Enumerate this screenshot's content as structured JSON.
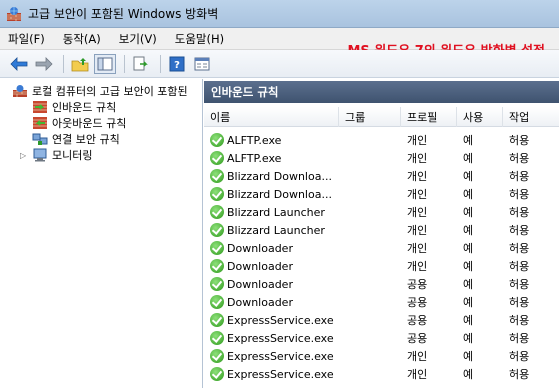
{
  "window": {
    "title": "고급 보안이 포함된 Windows 방화벽"
  },
  "menu": [
    "파일(F)",
    "동작(A)",
    "보기(V)",
    "도움말(H)"
  ],
  "overlay": "MS 윈도우 7의 윈도우 방화벽 설정",
  "tree": {
    "root": "로컬 컴퓨터의 고급 보안이 포함된",
    "items": [
      "인바운드 규칙",
      "아웃바운드 규칙",
      "연결 보안 규칙",
      "모니터링"
    ]
  },
  "pane": {
    "title": "인바운드 규칙",
    "columns": [
      "이름",
      "그룹",
      "프로필",
      "사용",
      "작업"
    ],
    "rows": [
      {
        "name": "ALFTP.exe",
        "group": "",
        "profile": "개인",
        "enabled": "예",
        "action": "허용"
      },
      {
        "name": "ALFTP.exe",
        "group": "",
        "profile": "개인",
        "enabled": "예",
        "action": "허용"
      },
      {
        "name": "Blizzard Downloa...",
        "group": "",
        "profile": "개인",
        "enabled": "예",
        "action": "허용"
      },
      {
        "name": "Blizzard Downloa...",
        "group": "",
        "profile": "개인",
        "enabled": "예",
        "action": "허용"
      },
      {
        "name": "Blizzard Launcher",
        "group": "",
        "profile": "개인",
        "enabled": "예",
        "action": "허용"
      },
      {
        "name": "Blizzard Launcher",
        "group": "",
        "profile": "개인",
        "enabled": "예",
        "action": "허용"
      },
      {
        "name": "Downloader",
        "group": "",
        "profile": "개인",
        "enabled": "예",
        "action": "허용"
      },
      {
        "name": "Downloader",
        "group": "",
        "profile": "개인",
        "enabled": "예",
        "action": "허용"
      },
      {
        "name": "Downloader",
        "group": "",
        "profile": "공용",
        "enabled": "예",
        "action": "허용"
      },
      {
        "name": "Downloader",
        "group": "",
        "profile": "공용",
        "enabled": "예",
        "action": "허용"
      },
      {
        "name": "ExpressService.exe",
        "group": "",
        "profile": "공용",
        "enabled": "예",
        "action": "허용"
      },
      {
        "name": "ExpressService.exe",
        "group": "",
        "profile": "공용",
        "enabled": "예",
        "action": "허용"
      },
      {
        "name": "ExpressService.exe",
        "group": "",
        "profile": "개인",
        "enabled": "예",
        "action": "허용"
      },
      {
        "name": "ExpressService.exe",
        "group": "",
        "profile": "개인",
        "enabled": "예",
        "action": "허용"
      }
    ]
  },
  "colors": {
    "accent": "#e01020",
    "header": "#4a5d7b"
  }
}
